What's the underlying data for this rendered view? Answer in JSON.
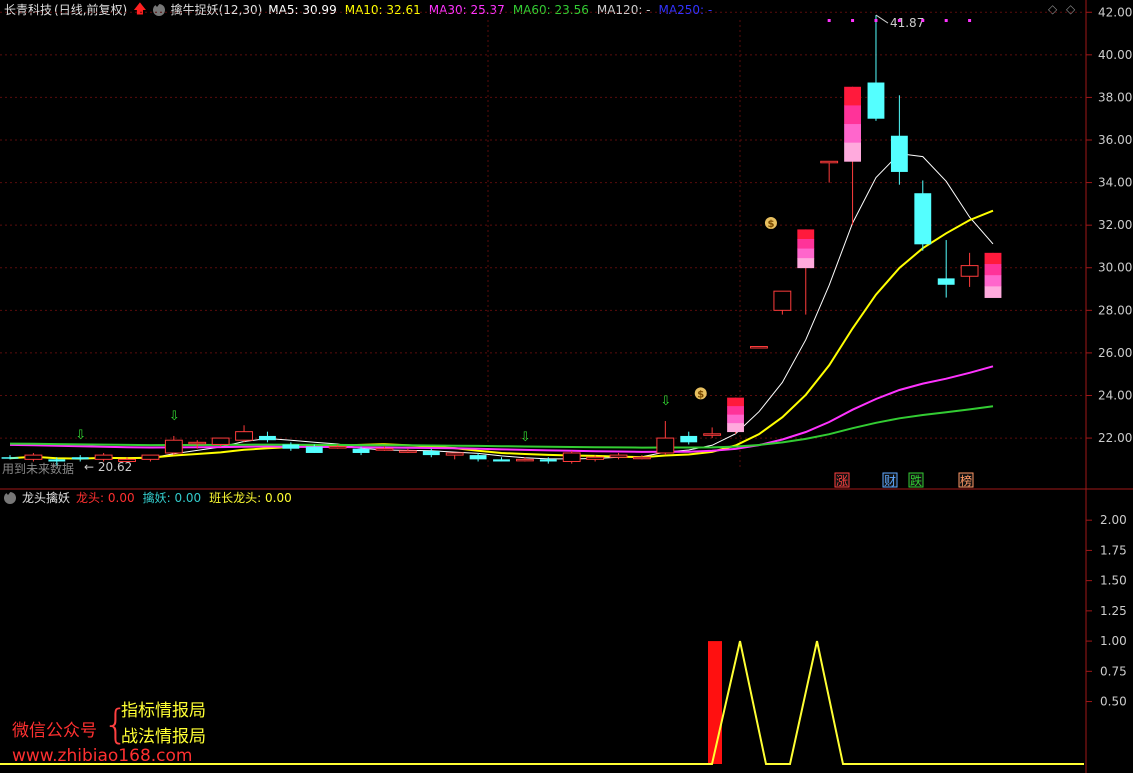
{
  "main_panel": {
    "stock_name": "长青科技",
    "period_label": "(日线,前复权)",
    "indicator_name": "擒牛捉妖(12,30)",
    "ma_readouts": [
      {
        "label": "MA5: 30.99",
        "color": "#ffffff"
      },
      {
        "label": "MA10: 32.61",
        "color": "#ffff00"
      },
      {
        "label": "MA30: 25.37",
        "color": "#ff33ff"
      },
      {
        "label": "MA60: 23.56",
        "color": "#33cc33"
      },
      {
        "label": "MA120: -",
        "color": "#cccccc"
      },
      {
        "label": "MA250: -",
        "color": "#3333ff"
      }
    ],
    "y_ticks": [
      "42.00",
      "40.00",
      "38.00",
      "36.00",
      "34.00",
      "32.00",
      "30.00",
      "28.00",
      "26.00",
      "24.00",
      "22.00"
    ],
    "high_label": "41.87",
    "low_label": "20.62",
    "future_data_note": "用到未来数据",
    "event_markers": [
      {
        "text": "涨",
        "color": "#ff4040"
      },
      {
        "text": "财",
        "color": "#5fa8ff"
      },
      {
        "text": "跌",
        "color": "#33cc33"
      },
      {
        "text": "榜",
        "color": "#ff9966"
      }
    ]
  },
  "sub_panel": {
    "indicator_name": "龙头擒妖",
    "readouts": [
      {
        "label": "龙头: 0.00",
        "color": "#ff3030"
      },
      {
        "label": "擒妖: 0.00",
        "color": "#33cccc"
      },
      {
        "label": "班长龙头: 0.00",
        "color": "#ffff33"
      }
    ],
    "y_ticks": [
      "2.00",
      "1.75",
      "1.50",
      "1.25",
      "1.00",
      "0.75",
      "0.50"
    ]
  },
  "watermark": {
    "line1": "微信公众号",
    "brace": "{",
    "item1": "指标情报局",
    "item2": "战法情报局",
    "url": "www.zhibiao168.com"
  },
  "chart_data": [
    {
      "type": "candlestick",
      "title": "擒牛捉妖(12,30)",
      "ylim": [
        20.5,
        42.2
      ],
      "candles": [
        {
          "o": 21.1,
          "h": 21.2,
          "l": 21.0,
          "c": 21.05
        },
        {
          "o": 21.0,
          "h": 21.3,
          "l": 20.9,
          "c": 21.2
        },
        {
          "o": 21.0,
          "h": 21.1,
          "l": 20.7,
          "c": 20.9
        },
        {
          "o": 21.1,
          "h": 21.2,
          "l": 20.9,
          "c": 21.0
        },
        {
          "o": 21.0,
          "h": 21.3,
          "l": 20.9,
          "c": 21.2
        },
        {
          "o": 20.9,
          "h": 21.1,
          "l": 20.9,
          "c": 21.0
        },
        {
          "o": 21.0,
          "h": 21.2,
          "l": 20.9,
          "c": 21.2
        },
        {
          "o": 21.3,
          "h": 22.1,
          "l": 21.2,
          "c": 21.9
        },
        {
          "o": 21.8,
          "h": 21.9,
          "l": 21.5,
          "c": 21.8
        },
        {
          "o": 21.7,
          "h": 22.0,
          "l": 21.6,
          "c": 22.0
        },
        {
          "o": 21.9,
          "h": 22.6,
          "l": 21.8,
          "c": 22.3
        },
        {
          "o": 22.1,
          "h": 22.3,
          "l": 21.8,
          "c": 21.9
        },
        {
          "o": 21.7,
          "h": 21.8,
          "l": 21.4,
          "c": 21.5
        },
        {
          "o": 21.6,
          "h": 21.7,
          "l": 21.3,
          "c": 21.3
        },
        {
          "o": 21.6,
          "h": 21.7,
          "l": 21.5,
          "c": 21.6
        },
        {
          "o": 21.5,
          "h": 21.6,
          "l": 21.2,
          "c": 21.3
        },
        {
          "o": 21.5,
          "h": 21.6,
          "l": 21.4,
          "c": 21.5
        },
        {
          "o": 21.4,
          "h": 21.5,
          "l": 21.3,
          "c": 21.4
        },
        {
          "o": 21.4,
          "h": 21.5,
          "l": 21.1,
          "c": 21.2
        },
        {
          "o": 21.2,
          "h": 21.3,
          "l": 21.0,
          "c": 21.3
        },
        {
          "o": 21.2,
          "h": 21.3,
          "l": 20.9,
          "c": 21.0
        },
        {
          "o": 21.0,
          "h": 21.1,
          "l": 20.9,
          "c": 20.9
        },
        {
          "o": 21.0,
          "h": 21.1,
          "l": 20.9,
          "c": 21.0
        },
        {
          "o": 21.0,
          "h": 21.1,
          "l": 20.8,
          "c": 20.9
        },
        {
          "o": 20.9,
          "h": 21.4,
          "l": 20.8,
          "c": 21.3
        },
        {
          "o": 21.0,
          "h": 21.2,
          "l": 20.9,
          "c": 21.1
        },
        {
          "o": 21.1,
          "h": 21.3,
          "l": 21.0,
          "c": 21.2
        },
        {
          "o": 21.1,
          "h": 21.2,
          "l": 21.0,
          "c": 21.1
        },
        {
          "o": 21.3,
          "h": 22.8,
          "l": 21.2,
          "c": 22.0
        },
        {
          "o": 22.1,
          "h": 22.3,
          "l": 21.7,
          "c": 21.8
        },
        {
          "o": 22.2,
          "h": 22.5,
          "l": 22.0,
          "c": 22.2
        },
        {
          "o": 22.3,
          "h": 23.9,
          "l": 22.2,
          "c": 23.9
        },
        {
          "o": 26.3,
          "h": 26.3,
          "l": 26.3,
          "c": 26.3
        },
        {
          "o": 28.0,
          "h": 28.9,
          "l": 27.8,
          "c": 28.9
        },
        {
          "o": 30.0,
          "h": 31.8,
          "l": 27.8,
          "c": 31.8
        },
        {
          "o": 35.0,
          "h": 35.0,
          "l": 34.0,
          "c": 35.0
        },
        {
          "o": 35.0,
          "h": 38.5,
          "l": 32.0,
          "c": 38.5
        },
        {
          "o": 38.7,
          "h": 41.87,
          "l": 36.9,
          "c": 37.0
        },
        {
          "o": 36.2,
          "h": 38.1,
          "l": 33.9,
          "c": 34.5
        },
        {
          "o": 33.5,
          "h": 34.1,
          "l": 30.8,
          "c": 31.1
        },
        {
          "o": 29.5,
          "h": 31.3,
          "l": 28.6,
          "c": 29.2
        },
        {
          "o": 29.6,
          "h": 30.7,
          "l": 29.1,
          "c": 30.1
        },
        {
          "o": 28.6,
          "h": 30.7,
          "l": 28.6,
          "c": 30.7
        }
      ],
      "series": [
        {
          "name": "MA5",
          "color": "#ffffff"
        },
        {
          "name": "MA10",
          "color": "#ffff00"
        },
        {
          "name": "MA30",
          "color": "#ff33ff"
        },
        {
          "name": "MA60",
          "color": "#33cc33"
        }
      ]
    },
    {
      "type": "line",
      "title": "龙头擒妖",
      "ylim": [
        0,
        2.2
      ],
      "series": [
        {
          "name": "班长龙头",
          "color": "#ffff33",
          "values": [
            0,
            0,
            0,
            0,
            0,
            0,
            0,
            0,
            0,
            0,
            0,
            0,
            0,
            0,
            0,
            0,
            0,
            0,
            0,
            0,
            0,
            0,
            0,
            0,
            0,
            0,
            0,
            0,
            0,
            0,
            0,
            0,
            0,
            0,
            0,
            0,
            0,
            0,
            0,
            0,
            0,
            0,
            0,
            0,
            1,
            0,
            0,
            1,
            0,
            0,
            0,
            0,
            0,
            0,
            0,
            0,
            0,
            0,
            0,
            0,
            0,
            0,
            0,
            0,
            0,
            0,
            0,
            0,
            0,
            0,
            0,
            0,
            0,
            0,
            0,
            0,
            0,
            0,
            0,
            0
          ]
        },
        {
          "name": "龙头",
          "color": "#ff1010",
          "bar_at": 0.0,
          "value": 1
        }
      ]
    }
  ]
}
